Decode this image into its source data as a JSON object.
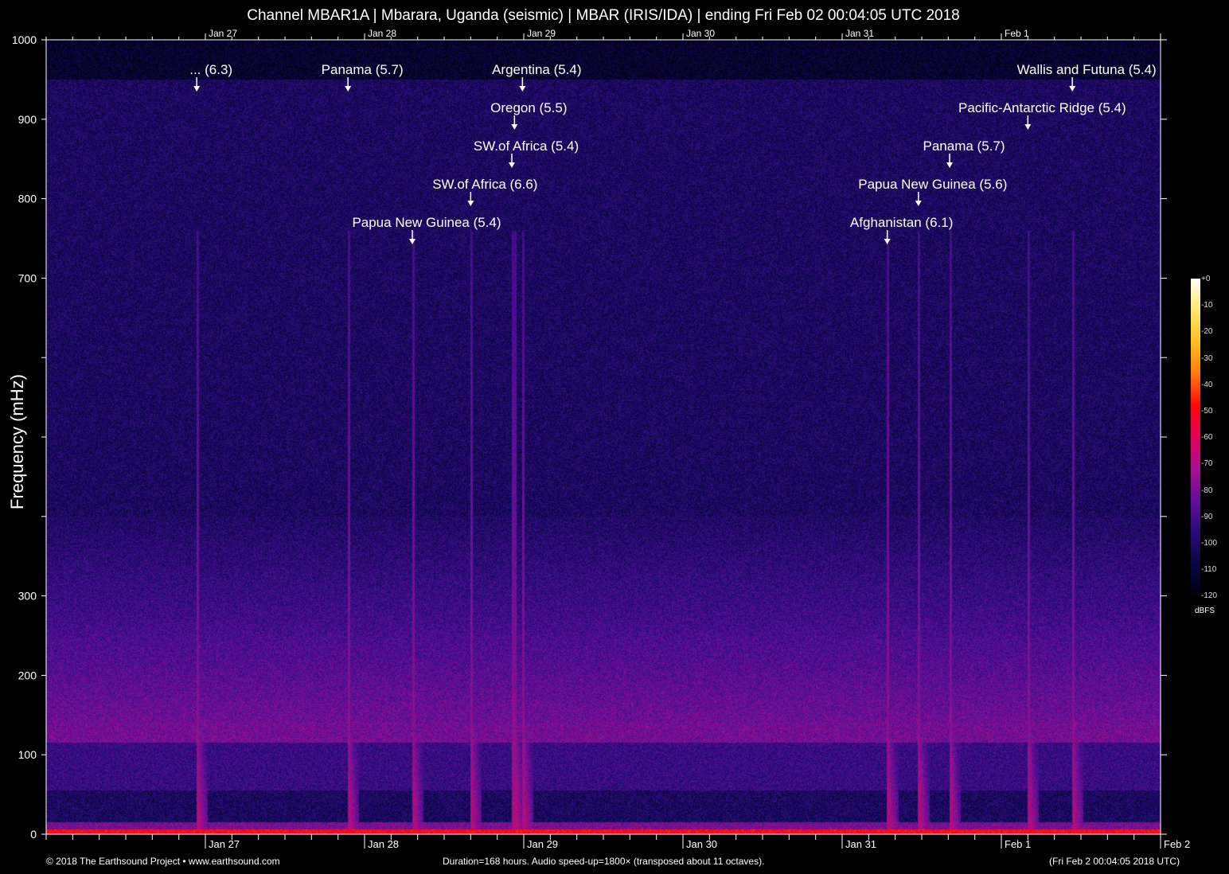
{
  "chart_data": {
    "type": "heatmap",
    "title": "Channel MBAR1A | Mbarara, Uganda (seismic) | MBAR (IRIS/IDA) | ending Fri Feb 02 00:04:05 UTC 2018",
    "xlabel": "",
    "ylabel": "Frequency (mHz)",
    "ylim": [
      0,
      1000
    ],
    "y_ticks": [
      0,
      100,
      200,
      300,
      400,
      500,
      600,
      700,
      800,
      900,
      1000
    ],
    "y_tick_labels": [
      "0",
      "100",
      "200",
      "300",
      "",
      "",
      "",
      "700",
      "800",
      "900",
      "1000"
    ],
    "x_range_hours": [
      0,
      168
    ],
    "x_tick_labels": [
      "Jan 27",
      "Jan 28",
      "Jan 29",
      "Jan 30",
      "Jan 31",
      "Feb  1",
      "Feb  2"
    ],
    "x_tick_hours": [
      24,
      48,
      72,
      96,
      120,
      144,
      168
    ],
    "colorbar": {
      "label": "dBFS",
      "range": [
        -120,
        0
      ],
      "ticks": [
        "+0",
        "-10",
        "-20",
        "-30",
        "-40",
        "-50",
        "-60",
        "-70",
        "-80",
        "-90",
        "-100",
        "-110",
        "-120"
      ]
    },
    "events": [
      {
        "label": "... (6.3)",
        "hour": 22.7
      },
      {
        "label": "Panama (5.7)",
        "hour": 45.5
      },
      {
        "label": "Argentina (5.4)",
        "hour": 71.8
      },
      {
        "label": "Oregon (5.5)",
        "hour": 70.6
      },
      {
        "label": "SW.of Africa (5.4)",
        "hour": 70.2
      },
      {
        "label": "SW.of Africa (6.6)",
        "hour": 64.0
      },
      {
        "label": "Papua New Guinea (5.4)",
        "hour": 55.2
      },
      {
        "label": "Wallis and Futuna (5.4)",
        "hour": 154.7
      },
      {
        "label": "Pacific-Antarctic Ridge (5.4)",
        "hour": 148.0
      },
      {
        "label": "Panama (5.7)",
        "hour": 136.2
      },
      {
        "label": "Papua New Guinea (5.6)",
        "hour": 131.5
      },
      {
        "label": "Afghanistan (6.1)",
        "hour": 126.8
      }
    ]
  },
  "footer": {
    "copyright": "© 2018 The Earthsound Project • www.earthsound.com",
    "info": "Duration=168 hours. Audio speed-up=1800× (transposed about 11 octaves).",
    "end_time": "(Fri Feb  2 00:04:05 2018 UTC)"
  }
}
